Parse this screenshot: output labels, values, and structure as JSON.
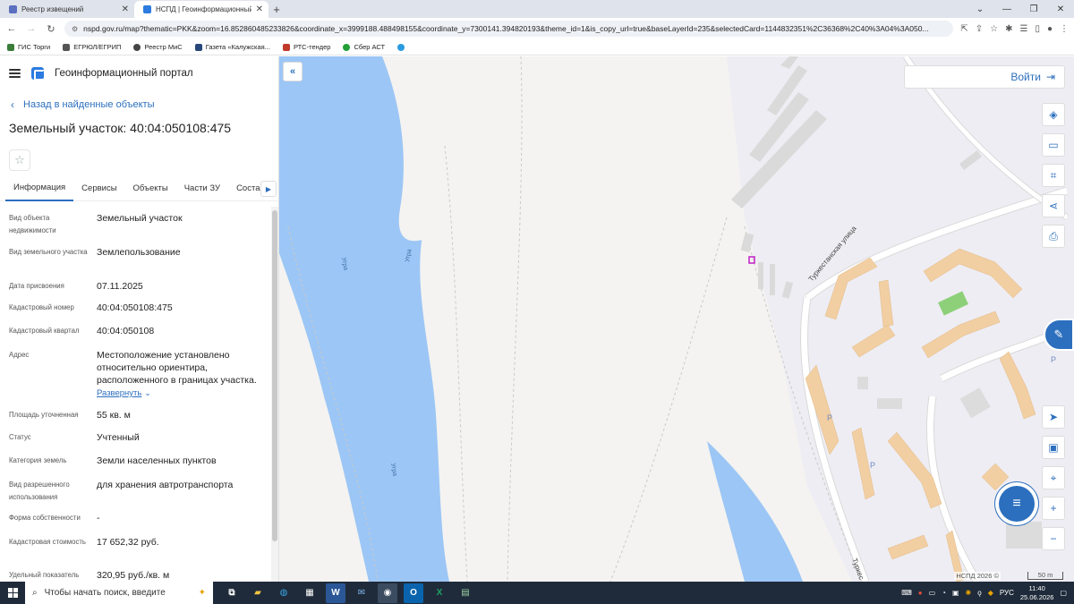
{
  "browser": {
    "tabs": [
      {
        "label": "Реестр извещений",
        "active": false
      },
      {
        "label": "НСПД | Геоинформационный п",
        "active": true
      }
    ],
    "new_tab": "+",
    "url": "nspd.gov.ru/map?thematic=PKK&zoom=16.852860485233826&coordinate_x=3999188.488498155&coordinate_y=7300141.394820193&theme_id=1&is_copy_url=true&baseLayerId=235&selectedCard=1144832351%2C36368%2C40%3A04%3A050...",
    "bookmarks": [
      "ГИС Торги",
      "ЕГРЮЛ/ЕГРИП",
      "Реестр МиС",
      "Газета «Калужская...",
      "РТС-тендер",
      "Сбер АСТ"
    ]
  },
  "sidebar": {
    "portal_title": "Геоинформационный портал",
    "back_label": "Назад в найденные объекты",
    "object_title": "Земельный участок: 40:04:050108:475",
    "tabs": [
      "Информация",
      "Сервисы",
      "Объекты",
      "Части ЗУ",
      "Состав"
    ],
    "properties": [
      {
        "key": "Вид объекта недвижимости",
        "value": "Земельный участок"
      },
      {
        "key": "Вид земельного участка",
        "value": "Землепользование"
      },
      {
        "key": "Дата присвоения",
        "value": "07.11.2025"
      },
      {
        "key": "Кадастровый номер",
        "value": "40:04:050108:475"
      },
      {
        "key": "Кадастровый квартал",
        "value": "40:04:050108"
      },
      {
        "key": "Адрес",
        "value": "Местоположение установлено относительно ориентира, расположенного в границах участка.",
        "expand": "Развернуть"
      },
      {
        "key": "Площадь уточненная",
        "value": "55 кв. м"
      },
      {
        "key": "Статус",
        "value": "Учтенный"
      },
      {
        "key": "Категория земель",
        "value": "Земли населенных пунктов"
      },
      {
        "key": "Вид разрешенного использования",
        "value": "для хранения автротранспорта"
      },
      {
        "key": "Форма собственности",
        "value": "-"
      },
      {
        "key": "Кадастровая стоимость",
        "value": "17 652,32 руб."
      },
      {
        "key": "Удельный показатель",
        "value": "320,95 руб./кв. м"
      }
    ]
  },
  "map": {
    "login_label": "Войти",
    "river_labels": [
      "Угра",
      "Угра",
      "Угра"
    ],
    "street_labels": [
      "Туркестанская улица",
      "Туркес"
    ],
    "parking_labels": [
      "P",
      "P",
      "P"
    ],
    "copyright": "НСПД 2026 ©",
    "scale": "50 m",
    "colors": {
      "water": "#9cc6f5",
      "building": "#f2cfa2",
      "green": "#8ed07a",
      "road": "#ffffff"
    }
  },
  "taskbar": {
    "search_placeholder": "Чтобы начать поиск, введите",
    "lang": "РУС",
    "time": "11:40",
    "date": "25.06.2026"
  }
}
